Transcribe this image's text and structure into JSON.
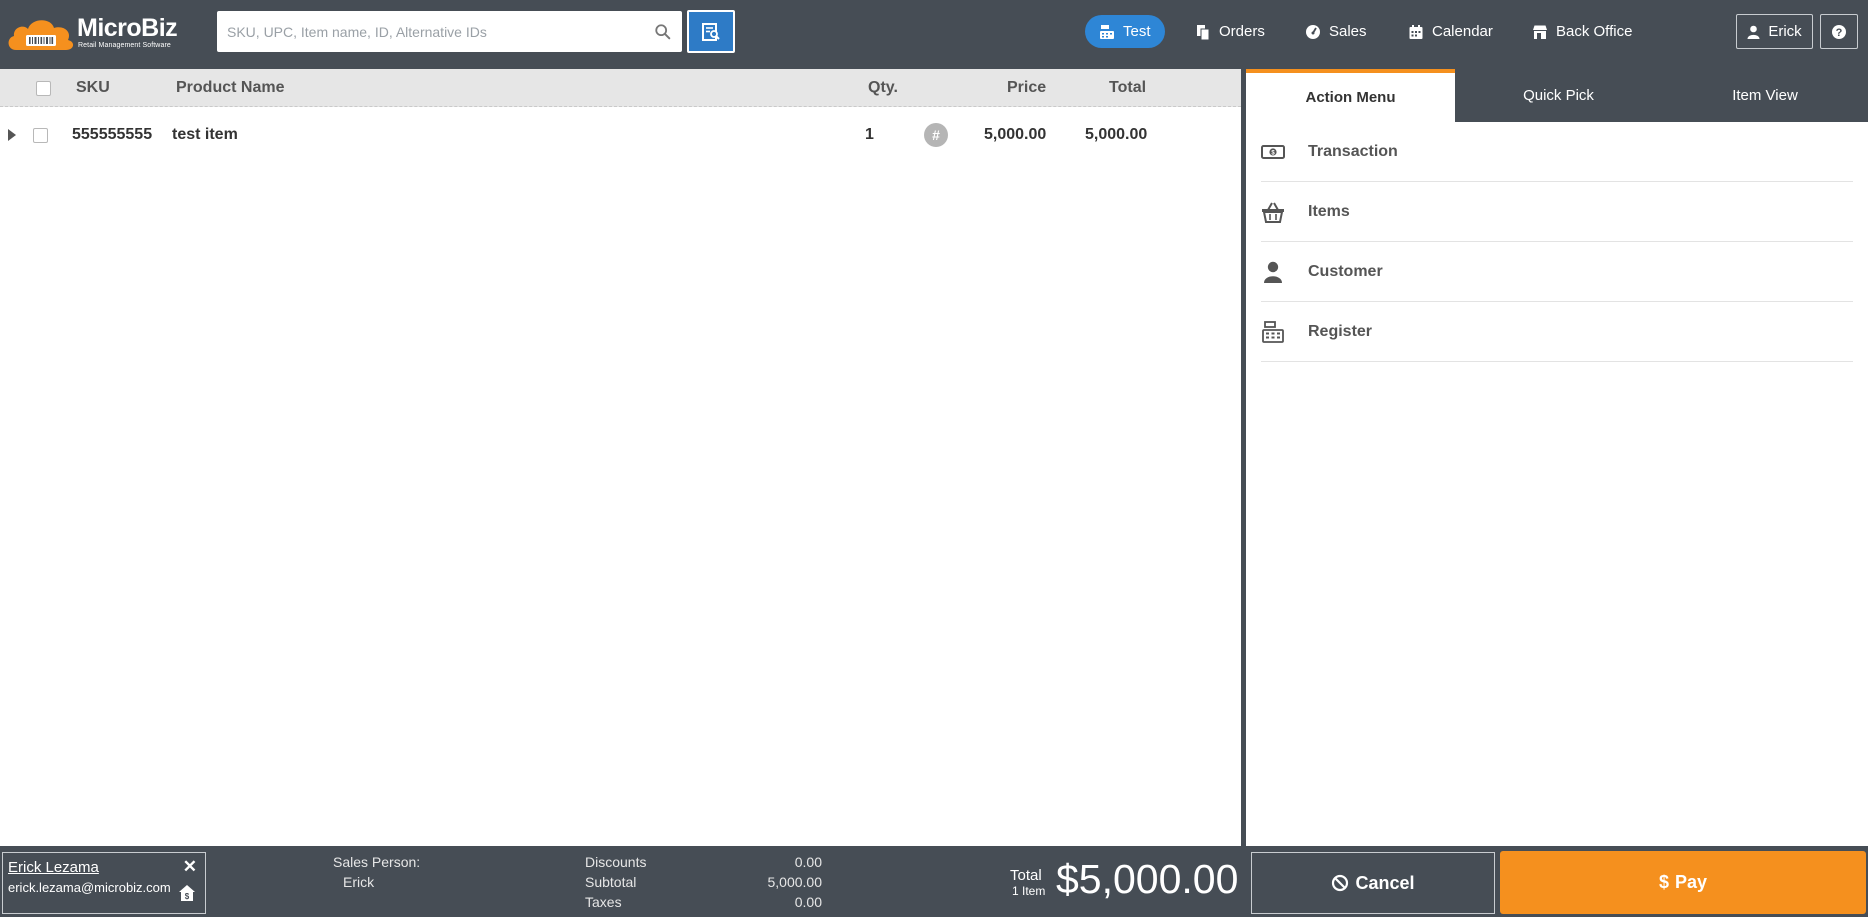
{
  "brand": {
    "name": "MicroBiz",
    "tagline": "Retail Management Software",
    "accent": "#f5901e"
  },
  "search": {
    "placeholder": "SKU, UPC, Item name, ID, Alternative IDs",
    "value": ""
  },
  "nav": {
    "items": [
      {
        "label": "Test",
        "icon": "register-icon",
        "active": true
      },
      {
        "label": "Orders",
        "icon": "orders-icon"
      },
      {
        "label": "Sales",
        "icon": "sales-gauge-icon"
      },
      {
        "label": "Calendar",
        "icon": "calendar-icon"
      },
      {
        "label": "Back Office",
        "icon": "store-icon"
      }
    ],
    "user": "Erick",
    "help": "?"
  },
  "grid": {
    "columns": {
      "sku": "SKU",
      "product": "Product Name",
      "qty": "Qty.",
      "price": "Price",
      "total": "Total"
    },
    "rows": [
      {
        "sku": "555555555",
        "product": "test item",
        "qty": "1",
        "price": "5,000.00",
        "total": "5,000.00",
        "qty_icon": "#"
      }
    ]
  },
  "panel": {
    "tabs": [
      {
        "label": "Action Menu",
        "active": true
      },
      {
        "label": "Quick Pick"
      },
      {
        "label": "Item View"
      }
    ],
    "menu": [
      {
        "label": "Transaction",
        "icon": "cash-icon"
      },
      {
        "label": "Items",
        "icon": "basket-icon"
      },
      {
        "label": "Customer",
        "icon": "person-icon"
      },
      {
        "label": "Register",
        "icon": "cash-register-icon"
      }
    ]
  },
  "footer": {
    "customer": {
      "name": "Erick Lezama",
      "email": "erick.lezama@microbiz.com"
    },
    "sales_person_label": "Sales Person:",
    "sales_person": "Erick",
    "discounts_label": "Discounts",
    "discounts": "0.00",
    "subtotal_label": "Subtotal",
    "subtotal": "5,000.00",
    "taxes_label": "Taxes",
    "taxes": "0.00",
    "total_label": "Total",
    "total_items": "1 Item",
    "total": "$5,000.00",
    "cancel_label": "Cancel",
    "pay_label": "Pay"
  }
}
